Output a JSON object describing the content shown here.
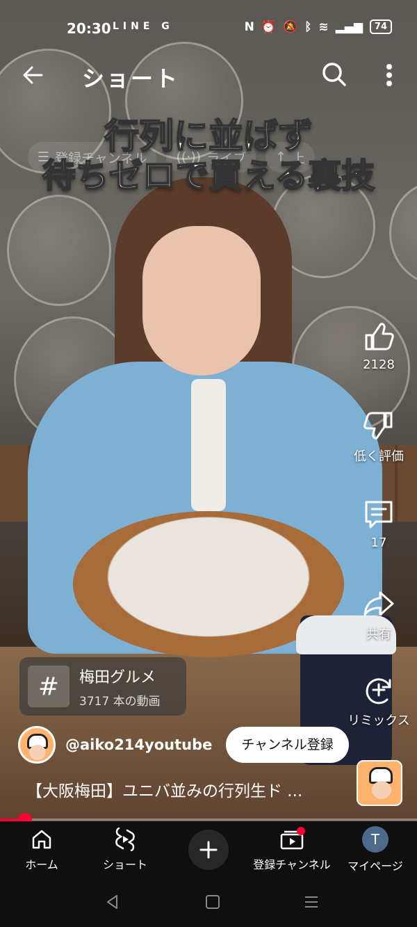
{
  "status_bar": {
    "time": "20:30",
    "app_icons": "LINE G",
    "battery": "74",
    "icons": [
      "nfc-icon",
      "alarm-icon",
      "mute-icon",
      "bluetooth-icon",
      "wifi-icon",
      "volte-icon",
      "signal-icon"
    ]
  },
  "header": {
    "title": "ショート"
  },
  "overlay": {
    "line1": "行列に並ばず",
    "line2": "待ちゼロで買える裏技",
    "chips": [
      "登録チャンネル",
      "ライブ",
      "上"
    ]
  },
  "actions": {
    "like_count": "2128",
    "dislike_label": "低く評価",
    "comment_count": "17",
    "share_label": "共有",
    "remix_label": "リミックス"
  },
  "hashtag": {
    "title": "梅田グルメ",
    "subtitle": "3717 本の動画"
  },
  "channel": {
    "handle": "@aiko214youtube",
    "subscribe_label": "チャンネル登録"
  },
  "video": {
    "title": "【大阪梅田】ユニバ並みの行列生ド ...",
    "progress": 0.06
  },
  "bottom_nav": {
    "home": "ホーム",
    "shorts": "ショート",
    "subscriptions": "登録チャンネル",
    "me": "マイページ",
    "me_initial": "T"
  },
  "colors": {
    "accent": "#ff0033",
    "nav_bg": "#0f0f0f"
  }
}
